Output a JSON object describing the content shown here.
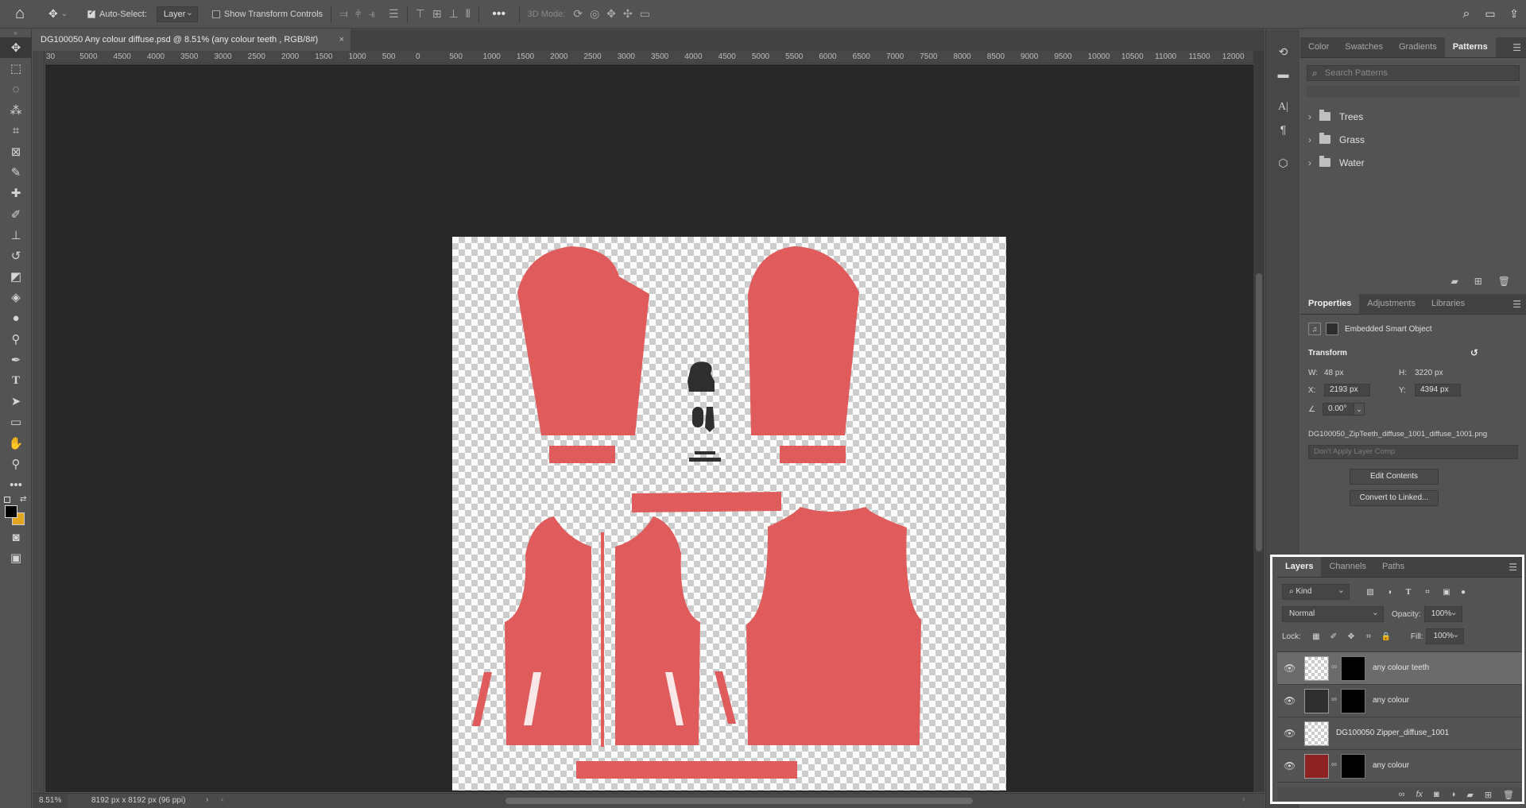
{
  "options_bar": {
    "auto_select_label": "Auto-Select:",
    "auto_select_checked": true,
    "layer_dropdown": "Layer",
    "show_transform_label": "Show Transform Controls",
    "mode_3d_label": "3D Mode:"
  },
  "document": {
    "tab_title": "DG100050 Any colour diffuse.psd @ 8.51% (any colour teeth , RGB/8#)",
    "ruler_ticks": [
      "30",
      "5000",
      "4500",
      "4000",
      "3500",
      "3000",
      "2500",
      "2000",
      "1500",
      "1000",
      "500",
      "0",
      "500",
      "1000",
      "1500",
      "2000",
      "2500",
      "3000",
      "3500",
      "4000",
      "4500",
      "5000",
      "5500",
      "6000",
      "6500",
      "7000",
      "7500",
      "8000",
      "8500",
      "9000",
      "9500",
      "10000",
      "10500",
      "11000",
      "11500",
      "12000"
    ],
    "garment_color": "#e05c5c",
    "zoom": "8.51%",
    "dimensions": "8192 px x 8192 px (96 ppi)"
  },
  "patterns_panel": {
    "tabs": [
      "Color",
      "Swatches",
      "Gradients",
      "Patterns"
    ],
    "active_tab": "Patterns",
    "search_placeholder": "Search Patterns",
    "folders": [
      "Trees",
      "Grass",
      "Water"
    ]
  },
  "properties_panel": {
    "tabs": [
      "Properties",
      "Adjustments",
      "Libraries"
    ],
    "object_type": "Embedded Smart Object",
    "section": "Transform",
    "w_label": "W:",
    "w_value": "48 px",
    "h_label": "H:",
    "h_value": "3220 px",
    "x_label": "X:",
    "x_value": "2193 px",
    "y_label": "Y:",
    "y_value": "4394 px",
    "angle_value": "0.00°",
    "filename": "DG100050_ZipTeeth_diffuse_1001_diffuse_1001.png",
    "layer_comp": "Don't Apply Layer Comp",
    "edit_contents": "Edit Contents",
    "convert_linked": "Convert to Linked..."
  },
  "layers_panel": {
    "tabs": [
      "Layers",
      "Channels",
      "Paths"
    ],
    "kind_label": "Kind",
    "blend_mode": "Normal",
    "opacity_label": "Opacity:",
    "opacity_value": "100%",
    "lock_label": "Lock:",
    "fill_label": "Fill:",
    "fill_value": "100%",
    "layers": [
      {
        "name": "any colour teeth",
        "selected": true
      },
      {
        "name": "any colour",
        "selected": false
      },
      {
        "name": "DG100050 Zipper_diffuse_1001",
        "selected": false
      },
      {
        "name": "any colour",
        "selected": false
      }
    ]
  }
}
